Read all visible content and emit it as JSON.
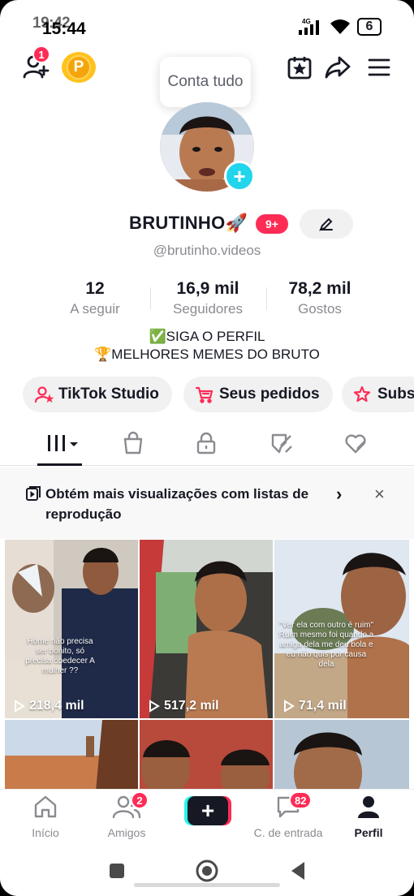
{
  "status_bar": {
    "time_ghost": "19:42",
    "time": "15:44",
    "network": "4G",
    "battery": "6"
  },
  "top_bar": {
    "follow_requests_count": "1",
    "coin_letter": "P",
    "tooltip": "Conta tudo"
  },
  "profile": {
    "username": "BRUTINHO🚀",
    "badge": "9+",
    "handle": "@brutinho.videos",
    "stats": [
      {
        "value": "12",
        "label": "A seguir"
      },
      {
        "value": "16,9 mil",
        "label": "Seguidores"
      },
      {
        "value": "78,2 mil",
        "label": "Gostos"
      }
    ],
    "bio_line1": "✅SIGA O PERFIL",
    "bio_line2": "🏆MELHORES MEMES DO BRUTO"
  },
  "pills": {
    "studio": "TikTok Studio",
    "orders": "Seus pedidos",
    "subs": "Subs"
  },
  "banner": {
    "text": "Obtém mais visualizações com listas de reprodução",
    "chevron": "›",
    "close": "×"
  },
  "videos": [
    {
      "views": "218,4 mil",
      "caption": "Home não precisa ser bonito, só precisa obedecer A mulher ??"
    },
    {
      "views": "517,2 mil",
      "caption": ""
    },
    {
      "views": "71,4 mil",
      "caption": "\"Ver ela com outro é ruim\" Ruim mesmo foi quando a amiga dela me deu bola e eu não quis por causa dela"
    }
  ],
  "bottom_nav": {
    "home": "Início",
    "friends": "Amigos",
    "friends_badge": "2",
    "create": "+",
    "inbox": "C. de entrada",
    "inbox_badge": "82",
    "profile": "Perfil"
  },
  "colors": {
    "accent_red": "#fe2c55",
    "accent_cyan": "#25f4ee",
    "text_primary": "#161823",
    "text_secondary": "#8a8b91"
  }
}
